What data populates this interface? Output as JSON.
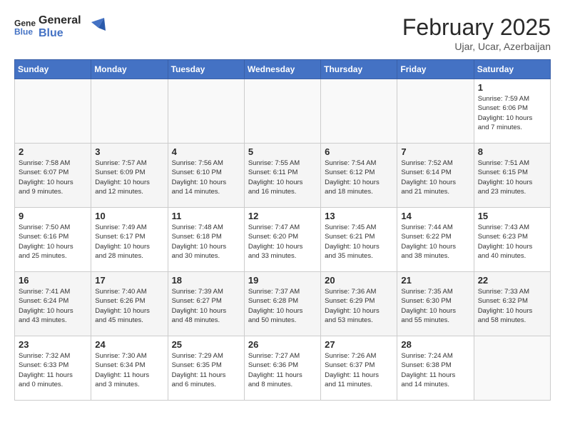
{
  "header": {
    "logo_line1": "General",
    "logo_line2": "Blue",
    "month": "February 2025",
    "location": "Ujar, Ucar, Azerbaijan"
  },
  "weekdays": [
    "Sunday",
    "Monday",
    "Tuesday",
    "Wednesday",
    "Thursday",
    "Friday",
    "Saturday"
  ],
  "weeks": [
    [
      {
        "day": "",
        "info": ""
      },
      {
        "day": "",
        "info": ""
      },
      {
        "day": "",
        "info": ""
      },
      {
        "day": "",
        "info": ""
      },
      {
        "day": "",
        "info": ""
      },
      {
        "day": "",
        "info": ""
      },
      {
        "day": "1",
        "info": "Sunrise: 7:59 AM\nSunset: 6:06 PM\nDaylight: 10 hours\nand 7 minutes."
      }
    ],
    [
      {
        "day": "2",
        "info": "Sunrise: 7:58 AM\nSunset: 6:07 PM\nDaylight: 10 hours\nand 9 minutes."
      },
      {
        "day": "3",
        "info": "Sunrise: 7:57 AM\nSunset: 6:09 PM\nDaylight: 10 hours\nand 12 minutes."
      },
      {
        "day": "4",
        "info": "Sunrise: 7:56 AM\nSunset: 6:10 PM\nDaylight: 10 hours\nand 14 minutes."
      },
      {
        "day": "5",
        "info": "Sunrise: 7:55 AM\nSunset: 6:11 PM\nDaylight: 10 hours\nand 16 minutes."
      },
      {
        "day": "6",
        "info": "Sunrise: 7:54 AM\nSunset: 6:12 PM\nDaylight: 10 hours\nand 18 minutes."
      },
      {
        "day": "7",
        "info": "Sunrise: 7:52 AM\nSunset: 6:14 PM\nDaylight: 10 hours\nand 21 minutes."
      },
      {
        "day": "8",
        "info": "Sunrise: 7:51 AM\nSunset: 6:15 PM\nDaylight: 10 hours\nand 23 minutes."
      }
    ],
    [
      {
        "day": "9",
        "info": "Sunrise: 7:50 AM\nSunset: 6:16 PM\nDaylight: 10 hours\nand 25 minutes."
      },
      {
        "day": "10",
        "info": "Sunrise: 7:49 AM\nSunset: 6:17 PM\nDaylight: 10 hours\nand 28 minutes."
      },
      {
        "day": "11",
        "info": "Sunrise: 7:48 AM\nSunset: 6:18 PM\nDaylight: 10 hours\nand 30 minutes."
      },
      {
        "day": "12",
        "info": "Sunrise: 7:47 AM\nSunset: 6:20 PM\nDaylight: 10 hours\nand 33 minutes."
      },
      {
        "day": "13",
        "info": "Sunrise: 7:45 AM\nSunset: 6:21 PM\nDaylight: 10 hours\nand 35 minutes."
      },
      {
        "day": "14",
        "info": "Sunrise: 7:44 AM\nSunset: 6:22 PM\nDaylight: 10 hours\nand 38 minutes."
      },
      {
        "day": "15",
        "info": "Sunrise: 7:43 AM\nSunset: 6:23 PM\nDaylight: 10 hours\nand 40 minutes."
      }
    ],
    [
      {
        "day": "16",
        "info": "Sunrise: 7:41 AM\nSunset: 6:24 PM\nDaylight: 10 hours\nand 43 minutes."
      },
      {
        "day": "17",
        "info": "Sunrise: 7:40 AM\nSunset: 6:26 PM\nDaylight: 10 hours\nand 45 minutes."
      },
      {
        "day": "18",
        "info": "Sunrise: 7:39 AM\nSunset: 6:27 PM\nDaylight: 10 hours\nand 48 minutes."
      },
      {
        "day": "19",
        "info": "Sunrise: 7:37 AM\nSunset: 6:28 PM\nDaylight: 10 hours\nand 50 minutes."
      },
      {
        "day": "20",
        "info": "Sunrise: 7:36 AM\nSunset: 6:29 PM\nDaylight: 10 hours\nand 53 minutes."
      },
      {
        "day": "21",
        "info": "Sunrise: 7:35 AM\nSunset: 6:30 PM\nDaylight: 10 hours\nand 55 minutes."
      },
      {
        "day": "22",
        "info": "Sunrise: 7:33 AM\nSunset: 6:32 PM\nDaylight: 10 hours\nand 58 minutes."
      }
    ],
    [
      {
        "day": "23",
        "info": "Sunrise: 7:32 AM\nSunset: 6:33 PM\nDaylight: 11 hours\nand 0 minutes."
      },
      {
        "day": "24",
        "info": "Sunrise: 7:30 AM\nSunset: 6:34 PM\nDaylight: 11 hours\nand 3 minutes."
      },
      {
        "day": "25",
        "info": "Sunrise: 7:29 AM\nSunset: 6:35 PM\nDaylight: 11 hours\nand 6 minutes."
      },
      {
        "day": "26",
        "info": "Sunrise: 7:27 AM\nSunset: 6:36 PM\nDaylight: 11 hours\nand 8 minutes."
      },
      {
        "day": "27",
        "info": "Sunrise: 7:26 AM\nSunset: 6:37 PM\nDaylight: 11 hours\nand 11 minutes."
      },
      {
        "day": "28",
        "info": "Sunrise: 7:24 AM\nSunset: 6:38 PM\nDaylight: 11 hours\nand 14 minutes."
      },
      {
        "day": "",
        "info": ""
      }
    ]
  ]
}
